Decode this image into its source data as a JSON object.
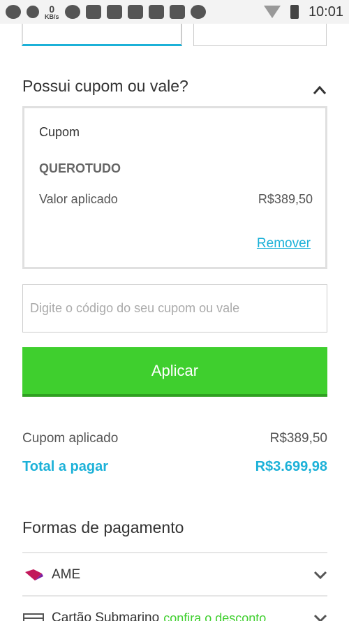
{
  "status_bar": {
    "kb_value": "0",
    "kb_unit": "KB/s",
    "time": "10:01"
  },
  "coupon_section": {
    "title": "Possui cupom ou vale?",
    "box": {
      "label": "Cupom",
      "code": "QUEROTUDO",
      "applied_label": "Valor aplicado",
      "applied_value": "R$389,50",
      "remove_label": "Remover"
    },
    "input": {
      "placeholder": "Digite o código do seu cupom ou vale",
      "value": ""
    },
    "apply_label": "Aplicar"
  },
  "summary": {
    "coupon_label": "Cupom aplicado",
    "coupon_value": "R$389,50",
    "total_label": "Total a pagar",
    "total_value": "R$3.699,98"
  },
  "payment": {
    "title": "Formas de pagamento",
    "methods": [
      {
        "label": "AME",
        "icon": "ame-icon",
        "note": ""
      },
      {
        "label": "Cartão Submarino",
        "icon": "card-icon",
        "note": "confira o desconto"
      }
    ]
  },
  "colors": {
    "accent_blue": "#1cb1d8",
    "apply_green": "#3fcf2e",
    "ame_pink": "#c2185b"
  }
}
